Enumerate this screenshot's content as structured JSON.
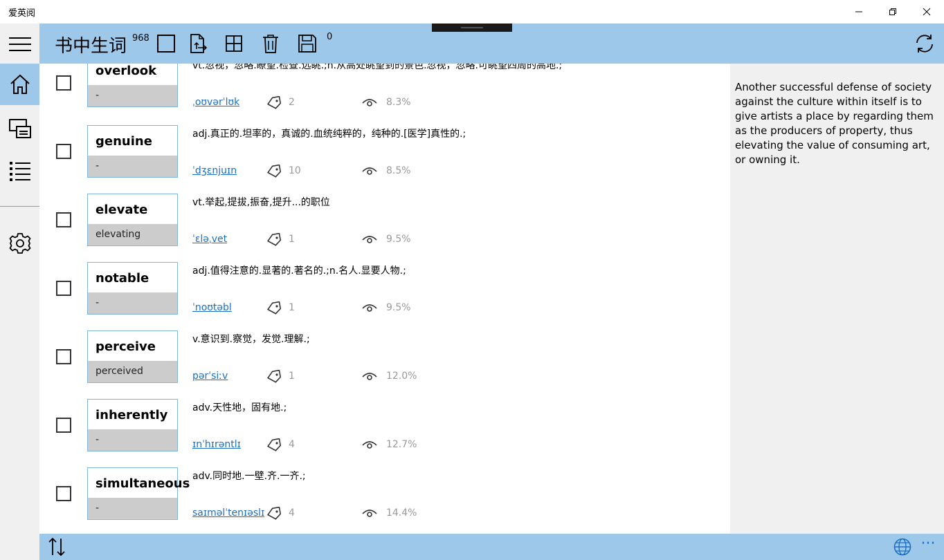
{
  "window": {
    "title": "爱英阅"
  },
  "toolbar": {
    "title": "书中生词",
    "word_count": "968",
    "selected_count": "0"
  },
  "words": [
    {
      "word": "overlook",
      "form": "-",
      "definition": "vt.忽视，忽略.瞭望.检查.远眺.;n.从高处眺望到的景色.忽视，忽略.可眺望四周的高地.;",
      "phonetic": "ˌoʊvərˈlʊk",
      "tags": "2",
      "percent": "8.3%"
    },
    {
      "word": "genuine",
      "form": "-",
      "definition": "adj.真正的.坦率的，真诚的.血统纯粹的，纯种的.[医学]真性的.;",
      "phonetic": "ˈdʒɛnjuɪn",
      "tags": "10",
      "percent": "8.5%"
    },
    {
      "word": "elevate",
      "form": "elevating",
      "definition": "vt.举起,提拔,振奋,提升...的职位",
      "phonetic": "ˈɛləˌvet",
      "tags": "1",
      "percent": "9.5%"
    },
    {
      "word": "notable",
      "form": "-",
      "definition": "adj.值得注意的.显著的.著名的.;n.名人.显要人物.;",
      "phonetic": "ˈnoʊtəbl",
      "tags": "1",
      "percent": "9.5%"
    },
    {
      "word": "perceive",
      "form": "perceived",
      "definition": "v.意识到.察觉，发觉.理解.;",
      "phonetic": "pərˈsiːv",
      "tags": "1",
      "percent": "12.0%"
    },
    {
      "word": "inherently",
      "form": "-",
      "definition": "adv.天性地，固有地.;",
      "phonetic": "ɪnˈhɪrəntlɪ",
      "tags": "4",
      "percent": "12.7%"
    },
    {
      "word": "simultaneous",
      "form": "-",
      "definition": "adv.同时地.一壁.齐.一齐.;",
      "phonetic": "saɪməlˈtenɪəslɪ",
      "tags": "4",
      "percent": "14.4%"
    }
  ],
  "context": {
    "text": "Another successful defense of society against the culture within itself is to give artists a place by regarding them as the producers of property, thus elevating the value of consuming art, or owning it."
  },
  "bottombar": {
    "more_label": "···"
  },
  "colors": {
    "accent": "#9ec8ea",
    "panel": "#f0f0f0",
    "link": "#1a6fc4",
    "card_border": "#7fb5e0",
    "form_bg": "#cccccc"
  }
}
